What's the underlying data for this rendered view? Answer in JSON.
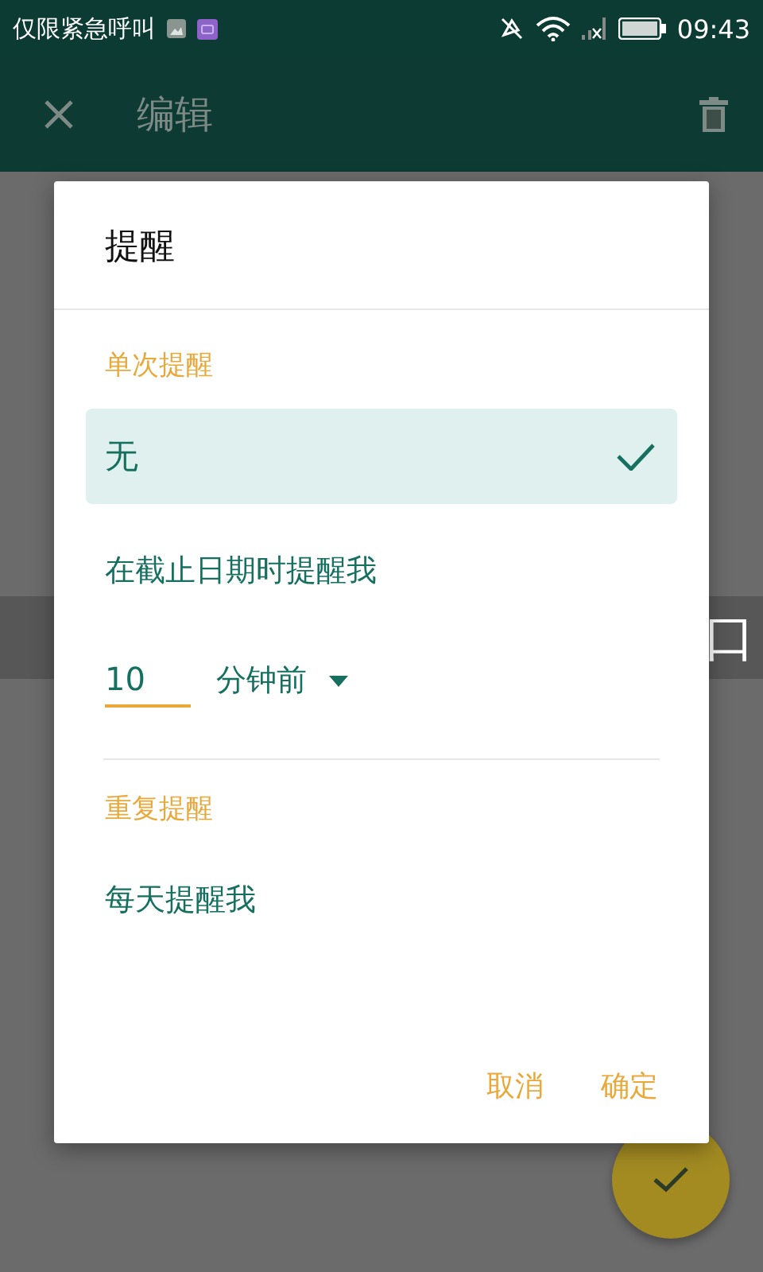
{
  "status_bar": {
    "carrier": "仅限紧急呼叫",
    "time": "09:43"
  },
  "app_bar": {
    "title": "编辑"
  },
  "background": {
    "banner_right": "口"
  },
  "dialog": {
    "title": "提醒",
    "single_section": {
      "heading": "单次提醒",
      "options": [
        {
          "label": "无",
          "selected": true
        },
        {
          "label": "在截止日期时提醒我",
          "selected": false
        }
      ],
      "minutes_value": "10",
      "unit": "分钟前"
    },
    "repeat_section": {
      "heading": "重复提醒",
      "options": [
        {
          "label": "每天提醒我",
          "selected": false
        }
      ]
    },
    "buttons": [
      "取消",
      "确定"
    ]
  }
}
